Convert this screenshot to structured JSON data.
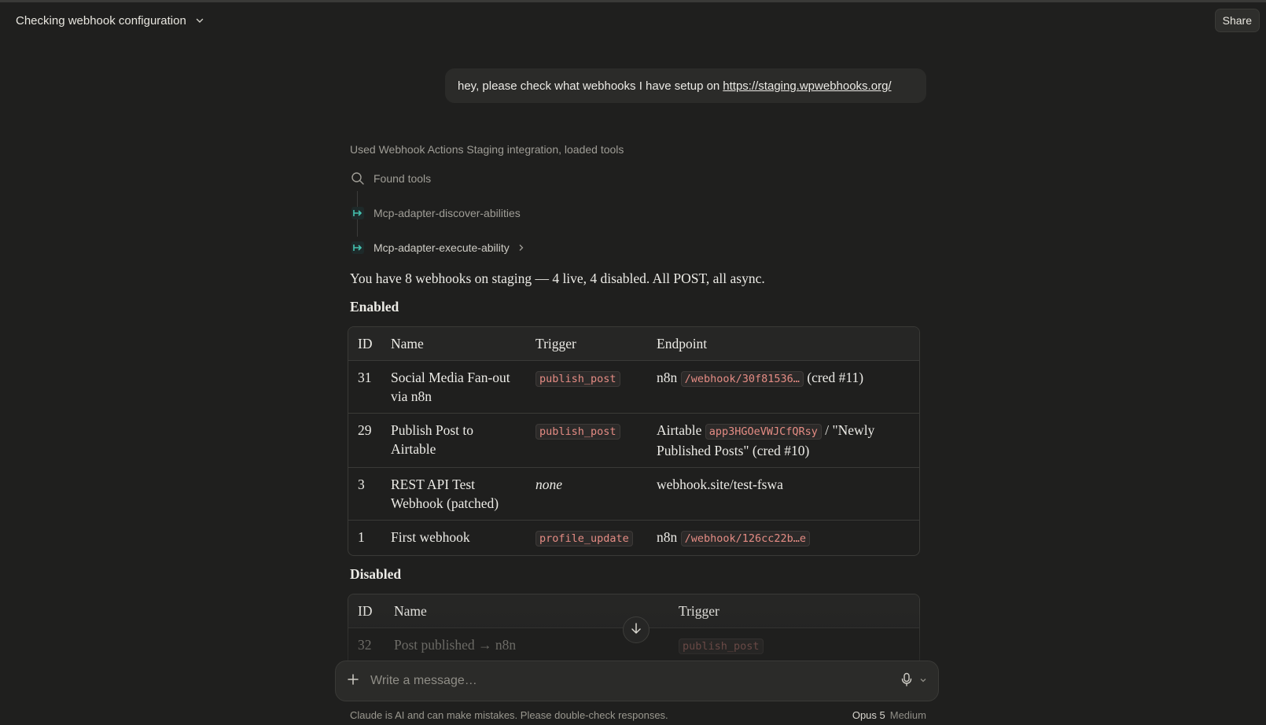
{
  "header": {
    "title": "Checking webhook configuration",
    "share_label": "Share"
  },
  "user_message": {
    "text": "hey, please check what webhooks I have setup on",
    "link": "https://staging.wpwebhooks.org/"
  },
  "tools": {
    "used_line": "Used Webhook Actions Staging integration, loaded tools",
    "items": [
      {
        "label": "Found tools",
        "icon": "search-icon"
      },
      {
        "label": "Mcp-adapter-discover-abilities",
        "icon": "mcp-tool-icon"
      },
      {
        "label": "Mcp-adapter-execute-ability",
        "icon": "mcp-tool-icon"
      }
    ]
  },
  "answer": {
    "summary": "You have 8 webhooks on staging — 4 live, 4 disabled. All POST, all async.",
    "enabled_heading": "Enabled",
    "disabled_heading": "Disabled",
    "enabled_table": {
      "headers": [
        "ID",
        "Name",
        "Trigger",
        "Endpoint"
      ],
      "rows": [
        {
          "id": "31",
          "name": "Social Media Fan-out via n8n",
          "trigger": "publish_post",
          "ep_pre": "n8n",
          "ep_code": "/webhook/30f81536…",
          "ep_post": "(cred #11)"
        },
        {
          "id": "29",
          "name": "Publish Post to Airtable",
          "trigger": "publish_post",
          "ep_pre": "Airtable",
          "ep_code": "app3HGOeVWJCfQRsy",
          "ep_post": "/ \"Newly Published Posts\" (cred #10)"
        },
        {
          "id": "3",
          "name": "REST API Test Webhook (patched)",
          "trigger_text": "none",
          "ep_text": "webhook.site/test-fswa"
        },
        {
          "id": "1",
          "name": "First webhook",
          "trigger": "profile_update",
          "ep_pre": "n8n",
          "ep_code": "/webhook/126cc22b…e"
        }
      ]
    },
    "disabled_table": {
      "headers": [
        "ID",
        "Name",
        "Trigger"
      ],
      "rows": [
        {
          "id": "32",
          "name": "Post published → n8n",
          "trigger": "publish_post"
        }
      ]
    }
  },
  "composer": {
    "placeholder": "Write a message…"
  },
  "footer": {
    "disclaimer": "Claude is AI and can make mistakes. Please double-check responses.",
    "model": "Opus 5",
    "effort": "Medium"
  }
}
